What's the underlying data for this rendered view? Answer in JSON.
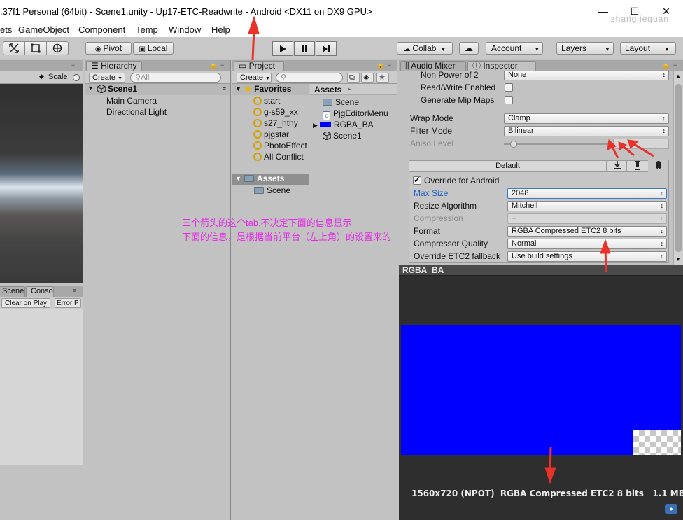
{
  "window": {
    "title": ".37f1 Personal (64bit) - Scene1.unity - Up17-ETC-Readwrite - Android <DX11 on DX9 GPU>",
    "watermark": "zhangjiequan",
    "controls": {
      "minimize": "—",
      "maximize": "☐",
      "close": "✕"
    }
  },
  "menu": [
    "ets",
    "GameObject",
    "Component",
    "Temp",
    "Window",
    "Help"
  ],
  "toolbar": {
    "pivot": "Pivot",
    "local": "Local",
    "collab": "Collab",
    "account": "Account",
    "layers": "Layers",
    "layout": "Layout"
  },
  "scene_view": {
    "scale_label": "Scale",
    "bottom_tabs": [
      "Scene",
      "Conso"
    ],
    "console_buttons": [
      "Clear on Play",
      "Error P"
    ]
  },
  "hierarchy": {
    "tab": "Hierarchy",
    "create": "Create",
    "search_placeholder": "All",
    "scene": "Scene1",
    "items": [
      "Main Camera",
      "Directional Light"
    ]
  },
  "project": {
    "tab": "Project",
    "create": "Create",
    "favorites_title": "Favorites",
    "favorites": [
      "start",
      "g-s59_xx",
      "s27_hthy",
      "pjgstar",
      "PhotoEffect",
      "All Conflict"
    ],
    "assets_title": "Assets",
    "assets_tree": [
      "Scene"
    ],
    "breadcrumb": "Assets",
    "assets": [
      "Scene",
      "PjgEditorMenu",
      "RGBA_BA",
      "Scene1"
    ]
  },
  "inspector": {
    "tabs": [
      "Audio Mixer",
      "Inspector"
    ],
    "rows": {
      "non_power_of_2": {
        "label": "Non Power of 2",
        "value": "None"
      },
      "read_write": {
        "label": "Read/Write Enabled",
        "checked": false
      },
      "generate_mip": {
        "label": "Generate Mip Maps",
        "checked": false
      },
      "wrap_mode": {
        "label": "Wrap Mode",
        "value": "Clamp"
      },
      "filter_mode": {
        "label": "Filter Mode",
        "value": "Bilinear"
      },
      "aniso_level": {
        "label": "Aniso Level",
        "value": 1
      }
    },
    "platform_tab": "Default",
    "override_android": "Override for Android",
    "platform_rows": {
      "max_size": {
        "label": "Max Size",
        "value": "2048"
      },
      "resize": {
        "label": "Resize Algorithm",
        "value": "Mitchell"
      },
      "compression": {
        "label": "Compression",
        "value": "--"
      },
      "format": {
        "label": "Format",
        "value": "RGBA Compressed ETC2 8 bits"
      },
      "quality": {
        "label": "Compressor Quality",
        "value": "Normal"
      },
      "etc2_fallback": {
        "label": "Override ETC2 fallback",
        "value": "Use build settings"
      }
    }
  },
  "preview": {
    "title": "RGBA_BA",
    "color": "#0000ff",
    "info": "1560x720 (NPOT)  RGBA Compressed ETC2 8 bits   1.1 MB"
  },
  "annotation": {
    "line1": "三个箭头的这个tab,不决定下面的信息显示",
    "line2": "下面的信息，是根据当前平台（左上角）的设置来的",
    "color": "#e628e6",
    "arrow_color": "#e8322a"
  }
}
